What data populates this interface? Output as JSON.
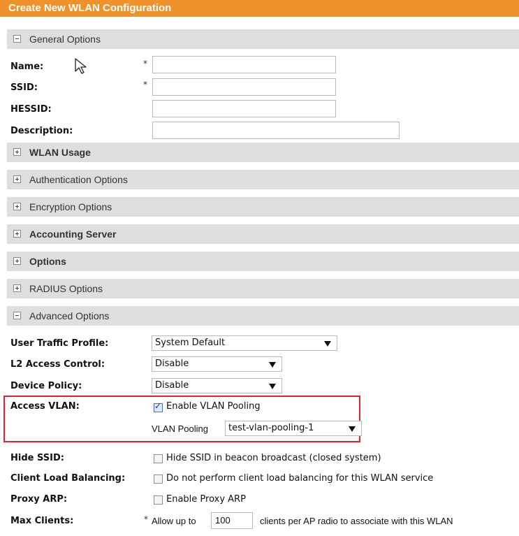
{
  "window_title": "Create New WLAN Configuration",
  "sections": {
    "general": "General Options",
    "wlan_usage": "WLAN Usage",
    "authentication": "Authentication Options",
    "encryption": "Encryption Options",
    "accounting": "Accounting Server",
    "options": "Options",
    "radius": "RADIUS Options",
    "advanced": "Advanced Options"
  },
  "general": {
    "name_label": "Name:",
    "ssid_label": "SSID:",
    "hessid_label": "HESSID:",
    "description_label": "Description:",
    "required_marker": "*",
    "name_value": "",
    "ssid_value": "",
    "hessid_value": "",
    "description_value": ""
  },
  "advanced": {
    "user_traffic_profile_label": "User Traffic Profile:",
    "user_traffic_profile_value": "System Default",
    "l2_access_control_label": "L2 Access Control:",
    "l2_access_control_value": "Disable",
    "device_policy_label": "Device Policy:",
    "device_policy_value": "Disable",
    "access_vlan_label": "Access VLAN:",
    "enable_vlan_pooling_label": "Enable VLAN Pooling",
    "enable_vlan_pooling_checked": true,
    "vlan_pooling_label": "VLAN Pooling",
    "vlan_pooling_value": "test-vlan-pooling-1",
    "hide_ssid_label": "Hide SSID:",
    "hide_ssid_text": "Hide SSID in beacon broadcast (closed system)",
    "hide_ssid_checked": false,
    "client_load_balancing_label": "Client Load Balancing:",
    "client_load_balancing_text": "Do not perform client load balancing for this WLAN service",
    "client_load_balancing_checked": false,
    "proxy_arp_label": "Proxy ARP:",
    "proxy_arp_text": "Enable Proxy ARP",
    "proxy_arp_checked": false,
    "max_clients_label": "Max Clients:",
    "max_clients_required": "*",
    "max_clients_prefix": "Allow up to",
    "max_clients_value": "100",
    "max_clients_suffix": "clients per AP radio to associate with this WLAN"
  },
  "icons": {
    "collapse": "minus-square-icon",
    "expand": "plus-square-icon",
    "cursor": "mouse-pointer-icon"
  },
  "colors": {
    "title_bar": "#f0922c",
    "section_header": "#dedede",
    "highlight_box": "#e0232b"
  }
}
